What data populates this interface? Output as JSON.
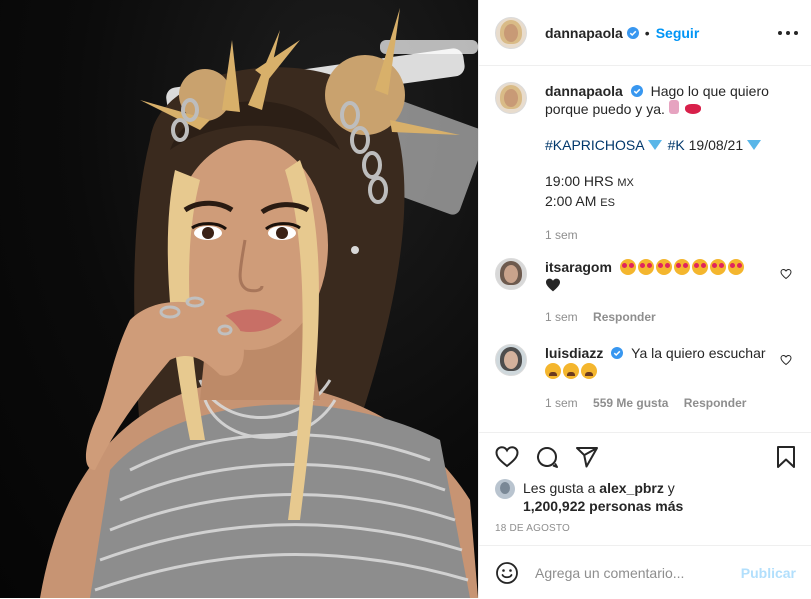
{
  "post": {
    "author": {
      "username": "dannapaola",
      "verified": true,
      "follow_label": "Seguir",
      "separator": "•"
    },
    "photo": {
      "alt": "Portrait photo"
    },
    "caption": {
      "username": "dannapaola",
      "text_intro": "Hago lo que quiero porque puedo y ya.",
      "hashtag1": "#KAPRICHOSA",
      "hashtag2": "#K",
      "release_date": "19/08/21",
      "time_mx": "19:00 HRS",
      "time_mx_suffix": "MX",
      "time_es": "2:00 AM",
      "time_es_suffix": "ES",
      "age": "1 sem"
    },
    "comments": [
      {
        "username": "itsaragom",
        "verified": false,
        "text": "",
        "age": "1 sem",
        "reply_label": "Responder"
      },
      {
        "username": "luisdiazz",
        "verified": true,
        "text": "Ya la quiero escuchar",
        "age": "1 sem",
        "likes_label": "559 Me gusta",
        "reply_label": "Responder"
      }
    ],
    "likes": {
      "prefix": "Les gusta a",
      "user": "alex_pbrz",
      "connector": "y",
      "count_text": "1,200,922 personas más"
    },
    "date": "18 DE AGOSTO",
    "comment_input": {
      "placeholder": "Agrega un comentario...",
      "publish_label": "Publicar"
    }
  },
  "colors": {
    "accent": "#0095f6",
    "publish_disabled": "#b2dffc",
    "text": "#262626",
    "muted": "#8e8e8e",
    "hashtag": "#00376b"
  }
}
